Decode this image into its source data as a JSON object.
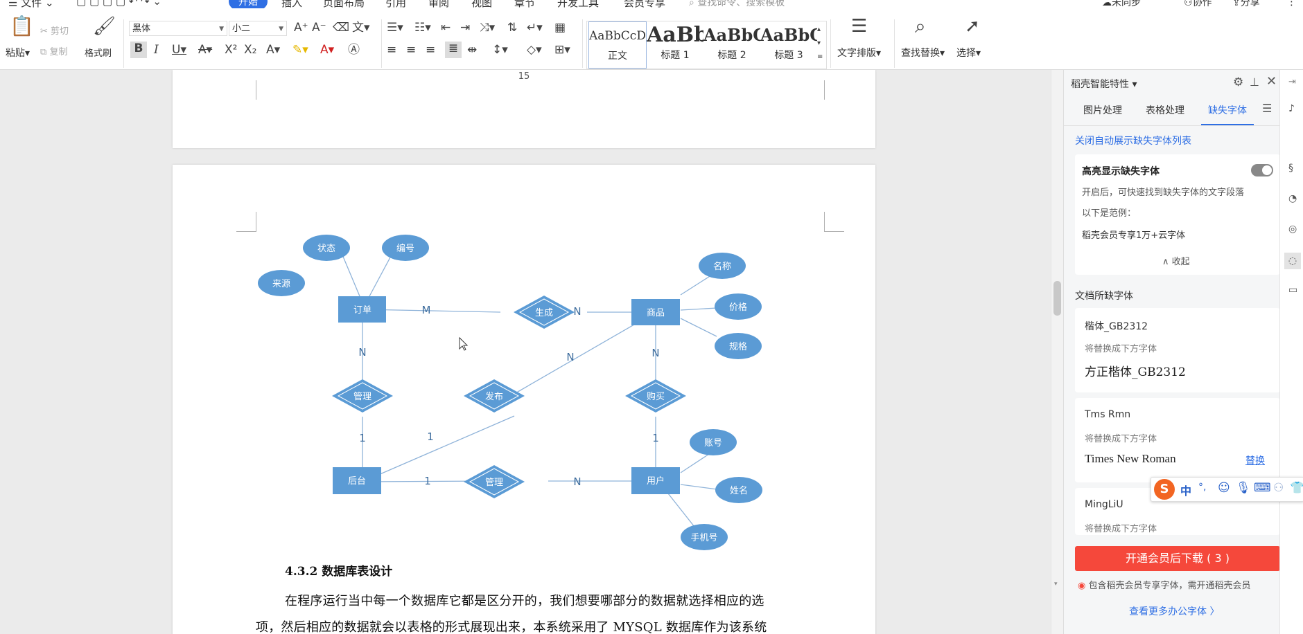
{
  "menu": {
    "file": "文件",
    "tabs": [
      "开始",
      "插入",
      "页面布局",
      "引用",
      "审阅",
      "视图",
      "章节",
      "开发工具",
      "会员专享"
    ],
    "search_placeholder": "查找命令、搜索模板",
    "right": {
      "sync": "未同步",
      "collab": "协作",
      "share": "分享"
    }
  },
  "ribbon": {
    "clipboard": {
      "paste": "粘贴",
      "cut": "剪切",
      "copy": "复制",
      "format_painter": "格式刷"
    },
    "font": {
      "family": "黑体",
      "size": "小二"
    },
    "styles": [
      {
        "preview": "AaBbCcDd",
        "name": "正文"
      },
      {
        "preview": "AaBb",
        "name": "标题 1"
      },
      {
        "preview": "AaBbC",
        "name": "标题 2"
      },
      {
        "preview": "AaBbC",
        "name": "标题 3"
      }
    ],
    "text_layout": "文字排版",
    "find_replace": "查找替换",
    "select": "选择"
  },
  "document": {
    "page_number": "15",
    "er_diagram": {
      "entities": [
        "订单",
        "商品",
        "后台",
        "用户"
      ],
      "attributes": [
        "状态",
        "编号",
        "来源",
        "名称",
        "价格",
        "规格",
        "账号",
        "姓名",
        "手机号"
      ],
      "relations": [
        "生成",
        "管理",
        "发布",
        "购买",
        "管理"
      ],
      "cardinalities": [
        "M",
        "N",
        "N",
        "N",
        "N",
        "1",
        "1",
        "1",
        "1",
        "N"
      ]
    },
    "section_heading": "4.3.2 数据库表设计",
    "paragraph_line1": "在程序运行当中每一个数据库它都是区分开的，我们想要哪部分的数据就选择相应的选",
    "paragraph_line2": "项，然后相应的数据就会以表格的形式展现出来，本系统采用了 MYSQL 数据库作为该系统"
  },
  "panel": {
    "title": "稻壳智能特性",
    "tabs": [
      "图片处理",
      "表格处理",
      "缺失字体"
    ],
    "close_auto_link": "关闭自动展示缺失字体列表",
    "highlight": {
      "title": "高亮显示缺失字体",
      "desc": "开启后，可快速找到缺失字体的文字段落",
      "example_label": "以下是范例：",
      "example": "稻壳会员专享1万+云字体",
      "collapse": "收起"
    },
    "missing_header": "文档所缺字体",
    "fonts": [
      {
        "name": "楷体_GB2312",
        "hint": "将替换成下方字体",
        "replacement": "方正楷体_GB2312",
        "action": ""
      },
      {
        "name": "Tms Rmn",
        "hint": "将替换成下方字体",
        "replacement": "Times New Roman",
        "action": "替换"
      },
      {
        "name": "MingLiU",
        "hint": "将替换成下方字体",
        "replacement": "",
        "action": ""
      }
    ],
    "download_button": "开通会员后下载 ( 3 )",
    "notice": "包含稻壳会员专享字体，需开通稻壳会员",
    "more_link": "查看更多办公字体 〉"
  },
  "ime": {
    "lang": "中",
    "punct": "°,"
  },
  "colors": {
    "accent": "#2f6fe4",
    "diagram": "#5b9bd5",
    "download": "#f5483b",
    "link": "#2f6fe4"
  }
}
